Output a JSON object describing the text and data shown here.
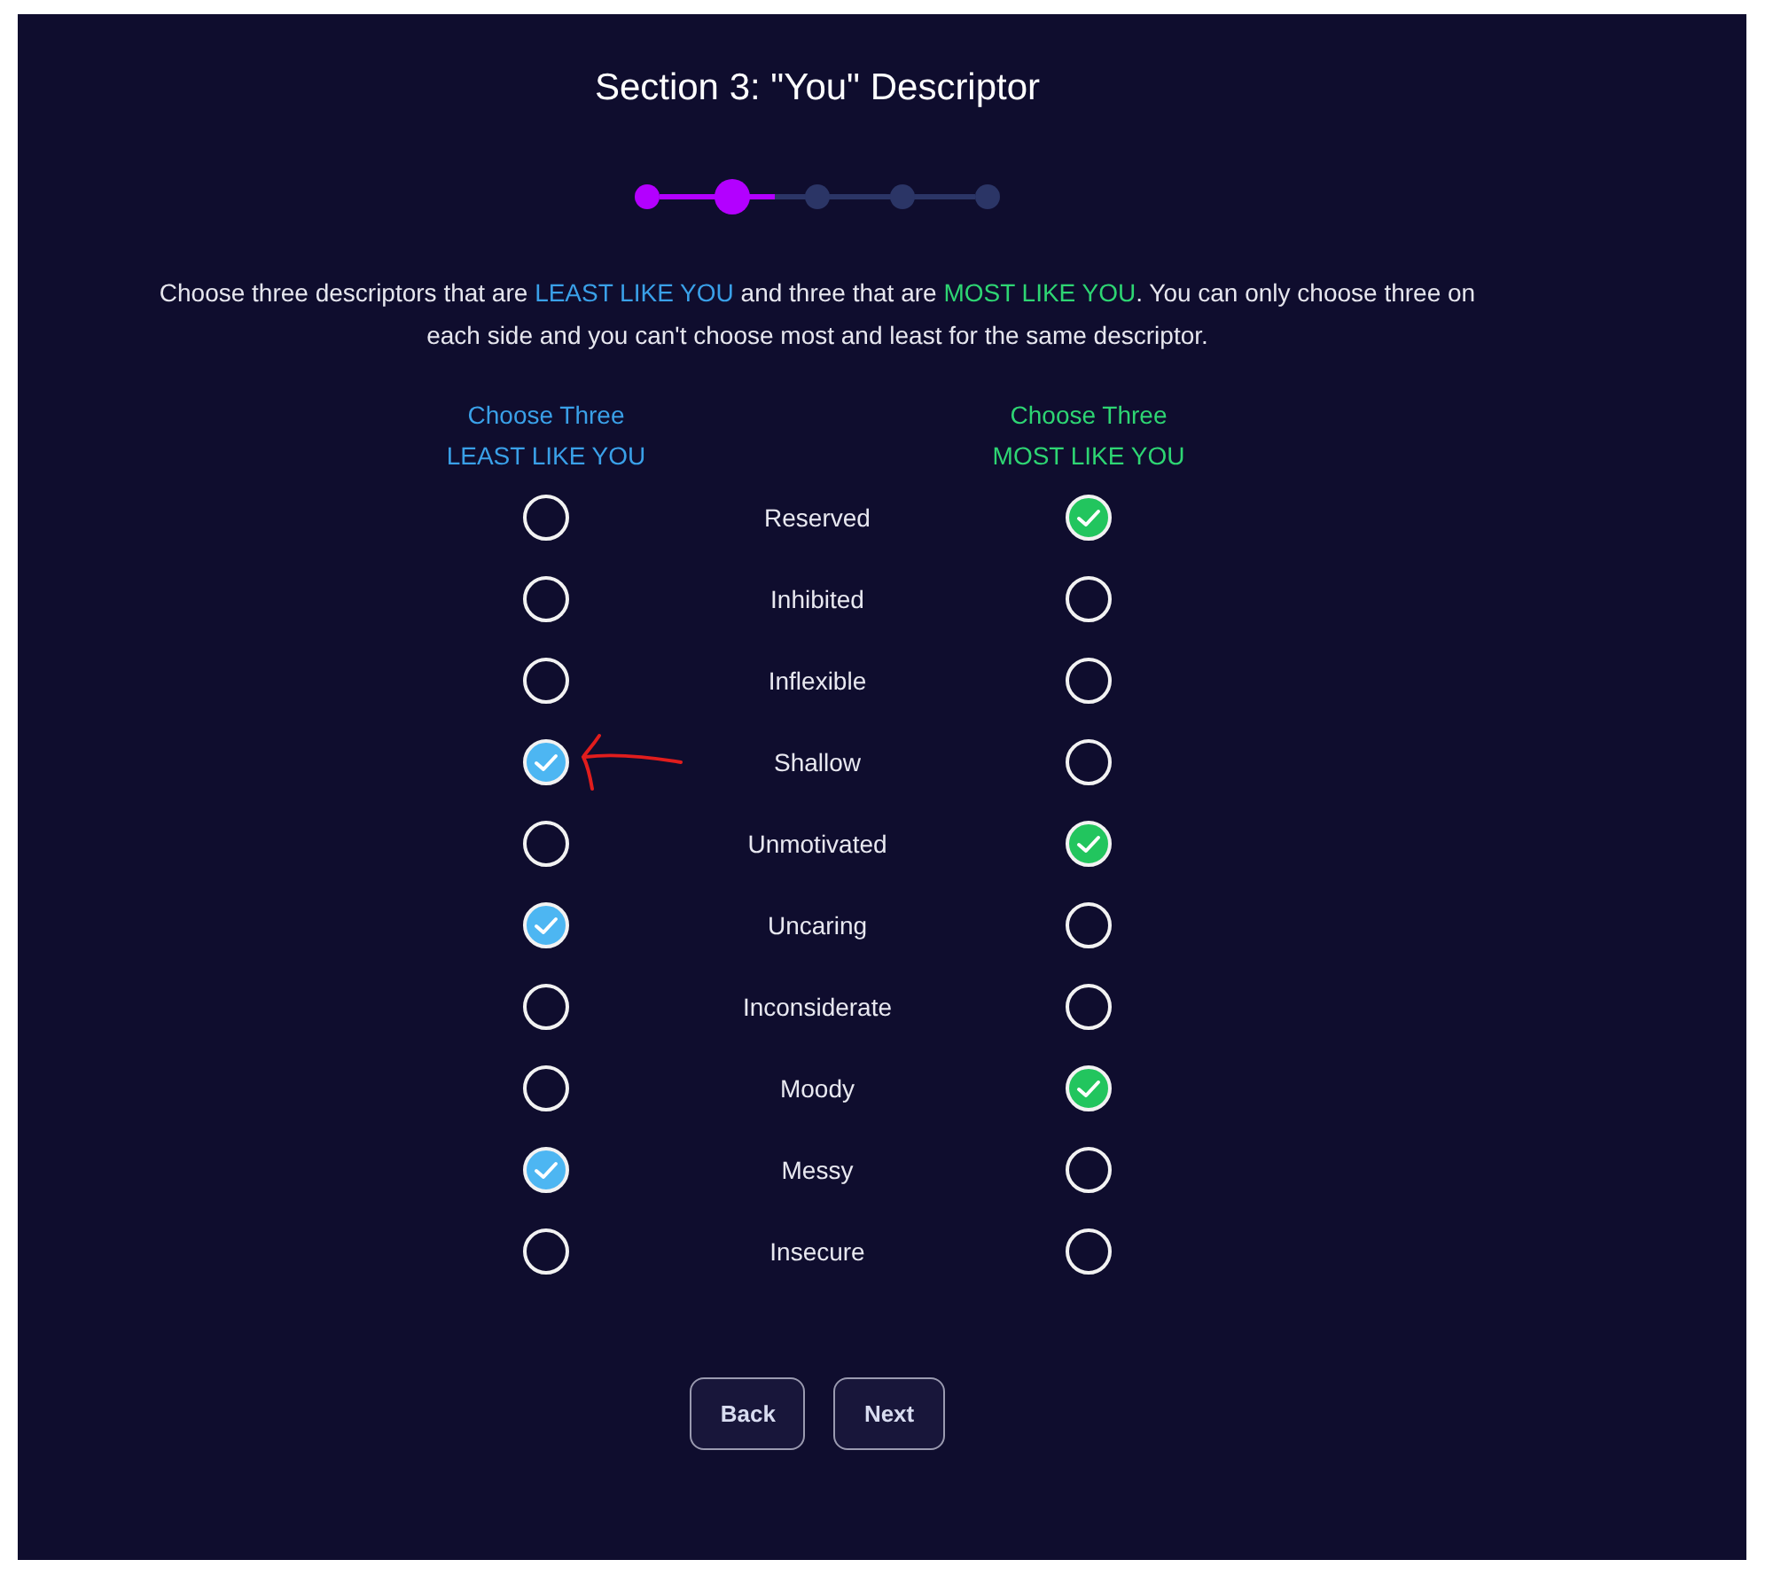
{
  "title": "Section 3: \"You\" Descriptor",
  "steps": [
    {
      "completed": true,
      "selected": false
    },
    {
      "completed": true,
      "selected": true
    },
    {
      "completed": false,
      "selected": false
    },
    {
      "completed": false,
      "selected": false
    },
    {
      "completed": false,
      "selected": false
    }
  ],
  "instructions": [
    {
      "kind": "plain",
      "text": "Choose three descriptors that are "
    },
    {
      "kind": "least",
      "text": "LEAST LIKE YOU"
    },
    {
      "kind": "plain",
      "text": " and three that are "
    },
    {
      "kind": "most",
      "text": "MOST LIKE YOU"
    },
    {
      "kind": "plain",
      "text": ". You can only choose three on each side and you can't choose most and least for the same descriptor."
    }
  ],
  "columns": [
    {
      "kind": "least",
      "lines": [
        "Choose Three",
        "LEAST LIKE YOU"
      ]
    },
    {
      "kind": "most",
      "lines": [
        "Choose Three",
        "MOST LIKE YOU"
      ]
    }
  ],
  "rows": [
    {
      "label": "Reserved",
      "least": false,
      "most": true,
      "annotated": false
    },
    {
      "label": "Inhibited",
      "least": false,
      "most": false,
      "annotated": false
    },
    {
      "label": "Inflexible",
      "least": false,
      "most": false,
      "annotated": false
    },
    {
      "label": "Shallow",
      "least": true,
      "most": false,
      "annotated": true
    },
    {
      "label": "Unmotivated",
      "least": false,
      "most": true,
      "annotated": false
    },
    {
      "label": "Uncaring",
      "least": true,
      "most": false,
      "annotated": false
    },
    {
      "label": "Inconsiderate",
      "least": false,
      "most": false,
      "annotated": false
    },
    {
      "label": "Moody",
      "least": false,
      "most": true,
      "annotated": false
    },
    {
      "label": "Messy",
      "least": true,
      "most": false,
      "annotated": false
    },
    {
      "label": "Insecure",
      "least": false,
      "most": false,
      "annotated": false
    }
  ],
  "buttons": [
    "Back",
    "Next"
  ]
}
